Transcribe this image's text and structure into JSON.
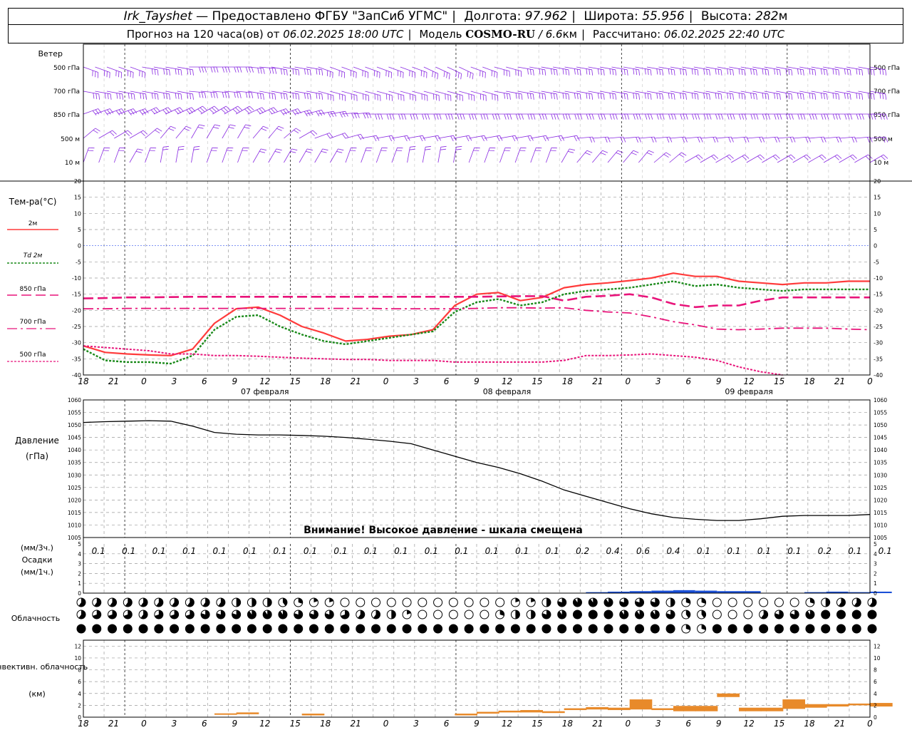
{
  "header": {
    "station": "Irk_Tayshet",
    "provider": "— Предоставлено ФГБУ \"ЗапСиб УГМС\"",
    "lon_label": "Долгота:",
    "lon": "97.962",
    "lat_label": "Широта:",
    "lat": "55.956",
    "alt_label": "Высота:",
    "alt": "282",
    "alt_unit": "м",
    "forecast_label": "Прогноз на 120 часа(ов) от",
    "forecast_from": "06.02.2025 18:00 UTC",
    "model_label": "Модель",
    "model": "COSMO-RU",
    "resolution": "/ 6.6",
    "resolution_unit": "км",
    "calc_label": "Рассчитано:",
    "calc_time": "06.02.2025 22:40 UTC"
  },
  "colors": {
    "wind": "#8a2be2",
    "t2m": "#ff3b3b",
    "td2m": "#1a8a1a",
    "t850": "#e8147a",
    "t700": "#e8147a",
    "t500": "#e8147a",
    "pressure": "#000000",
    "precip": "#1a4fd6",
    "convective": "#e88a2a",
    "grid": "#9a9a9a",
    "zero_line": "#3355ee"
  },
  "time_axis": {
    "ticks": [
      "18",
      "21",
      "0",
      "3",
      "6",
      "9",
      "12",
      "15",
      "18",
      "21",
      "0",
      "3",
      "6",
      "9",
      "12",
      "15",
      "18",
      "21",
      "0",
      "3",
      "6",
      "9",
      "12",
      "15",
      "18",
      "21",
      "0"
    ],
    "day_labels": [
      "07 февраля",
      "08 февраля",
      "09 февраля"
    ]
  },
  "wind_panel": {
    "title": "Ветер",
    "levels": [
      "500 гПа",
      "700 гПа",
      "850 гПа",
      "500 м",
      "10 м"
    ]
  },
  "chart_data": [
    {
      "type": "line",
      "title": "Тем-ра(°C)",
      "ylim": [
        -40,
        20
      ],
      "y_ticks": [
        "20",
        "15",
        "10",
        "5",
        "0",
        "-5",
        "-10",
        "-15",
        "-20",
        "-25",
        "-30",
        "-35",
        "-40"
      ],
      "x": [
        0,
        3,
        6,
        9,
        12,
        15,
        18,
        21,
        24,
        27,
        30,
        33,
        36,
        39,
        42,
        45,
        48,
        51,
        54,
        57,
        60,
        63,
        66,
        69,
        72,
        75,
        78,
        81,
        84,
        87,
        90,
        93,
        96,
        99,
        102,
        105,
        108
      ],
      "series": [
        {
          "name": "2м",
          "values": [
            -31,
            -33,
            -33.5,
            -33.8,
            -34,
            -32,
            -24,
            -19.5,
            -19,
            -21.5,
            -25,
            -27,
            -29.5,
            -29,
            -28,
            -27.5,
            -26,
            -18.5,
            -15,
            -14.5,
            -17,
            -16,
            -13,
            -12,
            -11.5,
            -10.8,
            -10,
            -8.5,
            -9.5,
            -9.5,
            -11,
            -11.5,
            -12,
            -11.5,
            -11.5,
            -11,
            -11
          ]
        },
        {
          "name": "Td 2м",
          "values": [
            -32,
            -35.5,
            -36,
            -36,
            -36.5,
            -34,
            -26,
            -22,
            -21.5,
            -25,
            -27.5,
            -29.5,
            -30.5,
            -29.5,
            -28.5,
            -27.5,
            -26.5,
            -20.5,
            -17.5,
            -16.5,
            -18.5,
            -17.5,
            -15,
            -14,
            -13.5,
            -13,
            -12,
            -11,
            -12.5,
            -12,
            -13,
            -13.5,
            -14,
            -13.5,
            -13.5,
            -13.5,
            -13.5
          ]
        },
        {
          "name": "850 гПа",
          "values": [
            -16.3,
            -16.2,
            -16,
            -16,
            -15.9,
            -15.8,
            -15.8,
            -15.8,
            -15.8,
            -15.8,
            -15.8,
            -15.8,
            -15.8,
            -15.8,
            -15.8,
            -15.8,
            -15.8,
            -15.8,
            -15.8,
            -15.7,
            -15.6,
            -15.6,
            -17,
            -15.8,
            -15.5,
            -15,
            -16,
            -18,
            -19,
            -18.5,
            -18.5,
            -17,
            -16,
            -16,
            -16,
            -16,
            -16
          ]
        },
        {
          "name": "700 гПа",
          "values": [
            -19.5,
            -19.5,
            -19.4,
            -19.4,
            -19.4,
            -19.4,
            -19.4,
            -19.4,
            -19.4,
            -19.4,
            -19.4,
            -19.4,
            -19.4,
            -19.4,
            -19.5,
            -19.5,
            -19.5,
            -19.5,
            -19.4,
            -19.2,
            -19.2,
            -19.3,
            -19.2,
            -20,
            -20.5,
            -20.8,
            -22,
            -23.5,
            -24.5,
            -25.8,
            -26,
            -25.8,
            -25.5,
            -25.5,
            -25.5,
            -25.8,
            -26
          ]
        },
        {
          "name": "500 гПа",
          "values": [
            -31,
            -31.5,
            -32,
            -32.5,
            -33.5,
            -33.5,
            -34,
            -34,
            -34.2,
            -34.5,
            -34.8,
            -35,
            -35.2,
            -35.2,
            -35.5,
            -35.5,
            -35.5,
            -36,
            -36,
            -36,
            -36,
            -36,
            -35.5,
            -34,
            -34,
            -33.8,
            -33.5,
            -34,
            -34.5,
            -35.5,
            -37.5,
            -39,
            -40.5,
            null,
            null,
            null,
            null
          ]
        }
      ]
    },
    {
      "type": "line",
      "title": "Давление",
      "ylabel": "(гПа)",
      "ylim": [
        1005,
        1060
      ],
      "y_ticks": [
        "1060",
        "1055",
        "1050",
        "1045",
        "1040",
        "1035",
        "1030",
        "1025",
        "1020",
        "1015",
        "1010",
        "1005"
      ],
      "note": "Внимание! Высокое давление - шкала смещена",
      "x": [
        0,
        3,
        6,
        9,
        12,
        15,
        18,
        21,
        24,
        27,
        30,
        33,
        36,
        39,
        42,
        45,
        48,
        51,
        54,
        57,
        60,
        63,
        66,
        69,
        72,
        75,
        78,
        81,
        84,
        87,
        90,
        93,
        96,
        99,
        102,
        105,
        108
      ],
      "series": [
        {
          "name": "Давление",
          "values": [
            1051,
            1051.3,
            1051.5,
            1051.7,
            1051.5,
            1049.5,
            1047,
            1046.3,
            1046,
            1046,
            1045.8,
            1045.5,
            1045,
            1044.3,
            1043.5,
            1042.5,
            1040,
            1037.5,
            1035,
            1033,
            1030.5,
            1027.5,
            1024,
            1021.5,
            1019,
            1016.5,
            1014.5,
            1013,
            1012.3,
            1011.8,
            1011.8,
            1012.5,
            1013.5,
            1013.8,
            1013.8,
            1013.8,
            1014.2
          ]
        }
      ]
    },
    {
      "type": "bar",
      "title": "Осадки",
      "ylabel_top": "(мм/3ч.)",
      "ylabel_bottom": "(мм/1ч.)",
      "ylim": [
        0,
        5
      ],
      "y_ticks": [
        "5",
        "4",
        "3",
        "2",
        "1",
        "0"
      ],
      "labels_3h": [
        "0.1",
        "0.1",
        "0.1",
        "0.1",
        "0.1",
        "0.1",
        "0.1",
        "0.1",
        "0.1",
        "0.1",
        "0.1",
        "0.1",
        "0.1",
        "0.1",
        "0.1",
        "0.1",
        "0.2",
        "0.4",
        "0.6",
        "0.4",
        "0.1",
        "0.1",
        "0.1",
        "0.1",
        "0.2",
        "0.1",
        "0.1"
      ],
      "x": [
        0,
        3,
        6,
        9,
        12,
        15,
        18,
        21,
        24,
        27,
        30,
        33,
        36,
        39,
        42,
        45,
        48,
        51,
        54,
        57,
        60,
        63,
        66,
        69,
        72,
        75,
        78,
        81,
        84,
        87,
        90,
        93,
        96,
        99,
        102,
        105,
        108
      ],
      "series": [
        {
          "name": "мм/1ч.",
          "values": [
            0.03,
            0.03,
            0.03,
            0.03,
            0.03,
            0.03,
            0.03,
            0.03,
            0.03,
            0.03,
            0.03,
            0.03,
            0.03,
            0.03,
            0.03,
            0.03,
            0.03,
            0.03,
            0.03,
            0.03,
            0.03,
            0.03,
            0.03,
            0.1,
            0.15,
            0.2,
            0.25,
            0.3,
            0.25,
            0.2,
            0.2,
            0.02,
            0.02,
            0.1,
            0.15,
            0.1,
            0.15
          ]
        }
      ]
    },
    {
      "type": "bar",
      "title": "Конвективн. облачность",
      "ylabel": "(км)",
      "ylim": [
        0,
        13
      ],
      "y_ticks": [
        "12",
        "10",
        "8",
        "6",
        "4",
        "2",
        "0"
      ],
      "x": [
        0,
        3,
        6,
        9,
        12,
        15,
        18,
        21,
        24,
        27,
        30,
        33,
        36,
        39,
        42,
        45,
        48,
        51,
        54,
        57,
        60,
        63,
        66,
        69,
        72,
        75,
        78,
        81,
        84,
        87,
        90,
        93,
        96,
        99,
        102,
        105,
        108
      ],
      "series": [
        {
          "name": "нижняя граница (км)",
          "values": [
            0,
            0,
            0,
            0,
            0,
            0,
            0.4,
            0.5,
            0,
            0,
            0.3,
            0,
            0,
            0,
            0,
            0,
            0,
            0.3,
            0.6,
            0.8,
            0.8,
            0.7,
            1.2,
            1.3,
            1.2,
            1.3,
            1.2,
            1,
            1,
            3.4,
            1,
            1,
            1.4,
            1.6,
            1.8,
            2,
            1.8
          ]
        },
        {
          "name": "верхняя граница (км)",
          "values": [
            0,
            0,
            0,
            0,
            0,
            0,
            0.6,
            0.8,
            0,
            0,
            0.6,
            0,
            0,
            0,
            0,
            0,
            0,
            0.6,
            0.9,
            1.1,
            1.2,
            1.0,
            1.5,
            1.7,
            1.6,
            3.0,
            1.5,
            1.9,
            1.9,
            4.0,
            1.6,
            1.6,
            3.0,
            2.2,
            2.2,
            2.3,
            2.4
          ]
        }
      ]
    }
  ],
  "cloud_panel": {
    "title": "Облачность",
    "rows": [
      {
        "name": "верхний ярус",
        "values": [
          0.6,
          0.6,
          0.6,
          0.6,
          0.6,
          0.6,
          0.6,
          0.5,
          0.5,
          0.4,
          0.3,
          0.2,
          0,
          0,
          0,
          0,
          0,
          0,
          0,
          0,
          0.2,
          0.5,
          0.8,
          0.9,
          0.9,
          0.8,
          0.8,
          0.5,
          0.3,
          0,
          0,
          0,
          0,
          0.3,
          0.5,
          0.6,
          0.6
        ]
      },
      {
        "name": "средний ярус",
        "values": [
          0.6,
          0.7,
          0.7,
          0.6,
          0.7,
          0.7,
          0.8,
          0.8,
          0.9,
          0.9,
          0.8,
          0.8,
          0.7,
          0.6,
          0.5,
          0.2,
          0,
          0,
          0,
          0.3,
          0.5,
          0.8,
          0.9,
          1,
          1,
          0.9,
          0.9,
          0.8,
          0.4,
          0,
          0,
          0.6,
          0.8,
          0.9,
          1,
          1,
          1
        ]
      },
      {
        "name": "нижний ярус",
        "values": [
          1,
          1,
          1,
          1,
          1,
          1,
          1,
          1,
          1,
          1,
          1,
          1,
          1,
          1,
          1,
          1,
          1,
          1,
          1,
          1,
          1,
          1,
          1,
          1,
          1,
          1,
          1,
          1,
          0.3,
          1,
          1,
          1,
          1,
          1,
          1,
          1,
          1
        ]
      }
    ]
  }
}
